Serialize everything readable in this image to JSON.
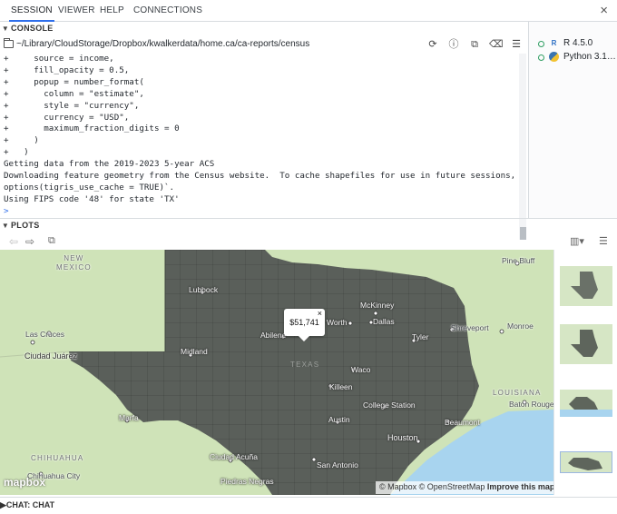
{
  "tabs": [
    {
      "label": "SESSION",
      "active": true
    },
    {
      "label": "VIEWER",
      "active": false
    },
    {
      "label": "HELP",
      "active": false
    },
    {
      "label": "CONNECTIONS",
      "active": false
    }
  ],
  "close_label": "×",
  "console": {
    "header": "CONSOLE",
    "path": "~/Library/CloudStorage/Dropbox/kwalkerdata/home.ca/ca-reports/census",
    "lines": [
      "+     source = income,",
      "+     fill_opacity = 0.5,",
      "+     popup = number_format(",
      "+       column = \"estimate\",",
      "+       style = \"currency\",",
      "+       currency = \"USD\",",
      "+       maximum_fraction_digits = 0",
      "+     )",
      "+   )",
      "Getting data from the 2019-2023 5-year ACS",
      "Downloading feature geometry from the Census website.  To cache shapefiles for use in future sessions, set `",
      "options(tigris_use_cache = TRUE)`.",
      "Using FIPS code '48' for state 'TX'",
      ">"
    ]
  },
  "sessions": [
    {
      "name": "R 4.5.0",
      "lang": "R"
    },
    {
      "name": "Python 3.1…",
      "lang": "Py"
    }
  ],
  "plots": {
    "header": "PLOTS",
    "popup_value": "$51,741",
    "popup_close": "×",
    "map_labels": {
      "new_mexico": "NEW\nMEXICO",
      "texas": "TEXAS",
      "chihuahua": "CHIHUAHUA",
      "louisiana": "LOUISIANA",
      "lubbock": "Lubbock",
      "mckinney": "McKinney",
      "dallas": "Dallas",
      "worth": "Worth",
      "abilene": "Abilene",
      "tyler": "Tyler",
      "shreveport": "Shreveport",
      "monroe": "Monroe",
      "pine_bluff": "Pine Bluff",
      "las_cruces": "Las Cruces",
      "ciudad_juarez": "Ciudad Juárez",
      "midland": "Midland",
      "waco": "Waco",
      "killeen": "Killeen",
      "college_station": "College Station",
      "baton_rouge": "Baton Rouge",
      "marfa": "Marfa",
      "austin": "Austin",
      "houston": "Houston",
      "beaumont": "Beaumont",
      "san_antonio": "San Antonio",
      "ciudad_acuna": "Ciudad Acuña",
      "piedras_negras": "Piedras Negras",
      "chihuahua_city": "Chihuahua City"
    },
    "mapbox_logo": "mapbox",
    "attribution": {
      "mapbox": "© Mapbox",
      "osm": "© OpenStreetMap",
      "improve": "Improve this map"
    }
  },
  "chat": {
    "header": "CHAT: CHAT"
  },
  "colors": {
    "accent": "#2f6feb",
    "county_fill": "#5a5f5a",
    "water": "#a8d4ef",
    "land": "#cfe3b8",
    "running": "#2f9e62"
  }
}
